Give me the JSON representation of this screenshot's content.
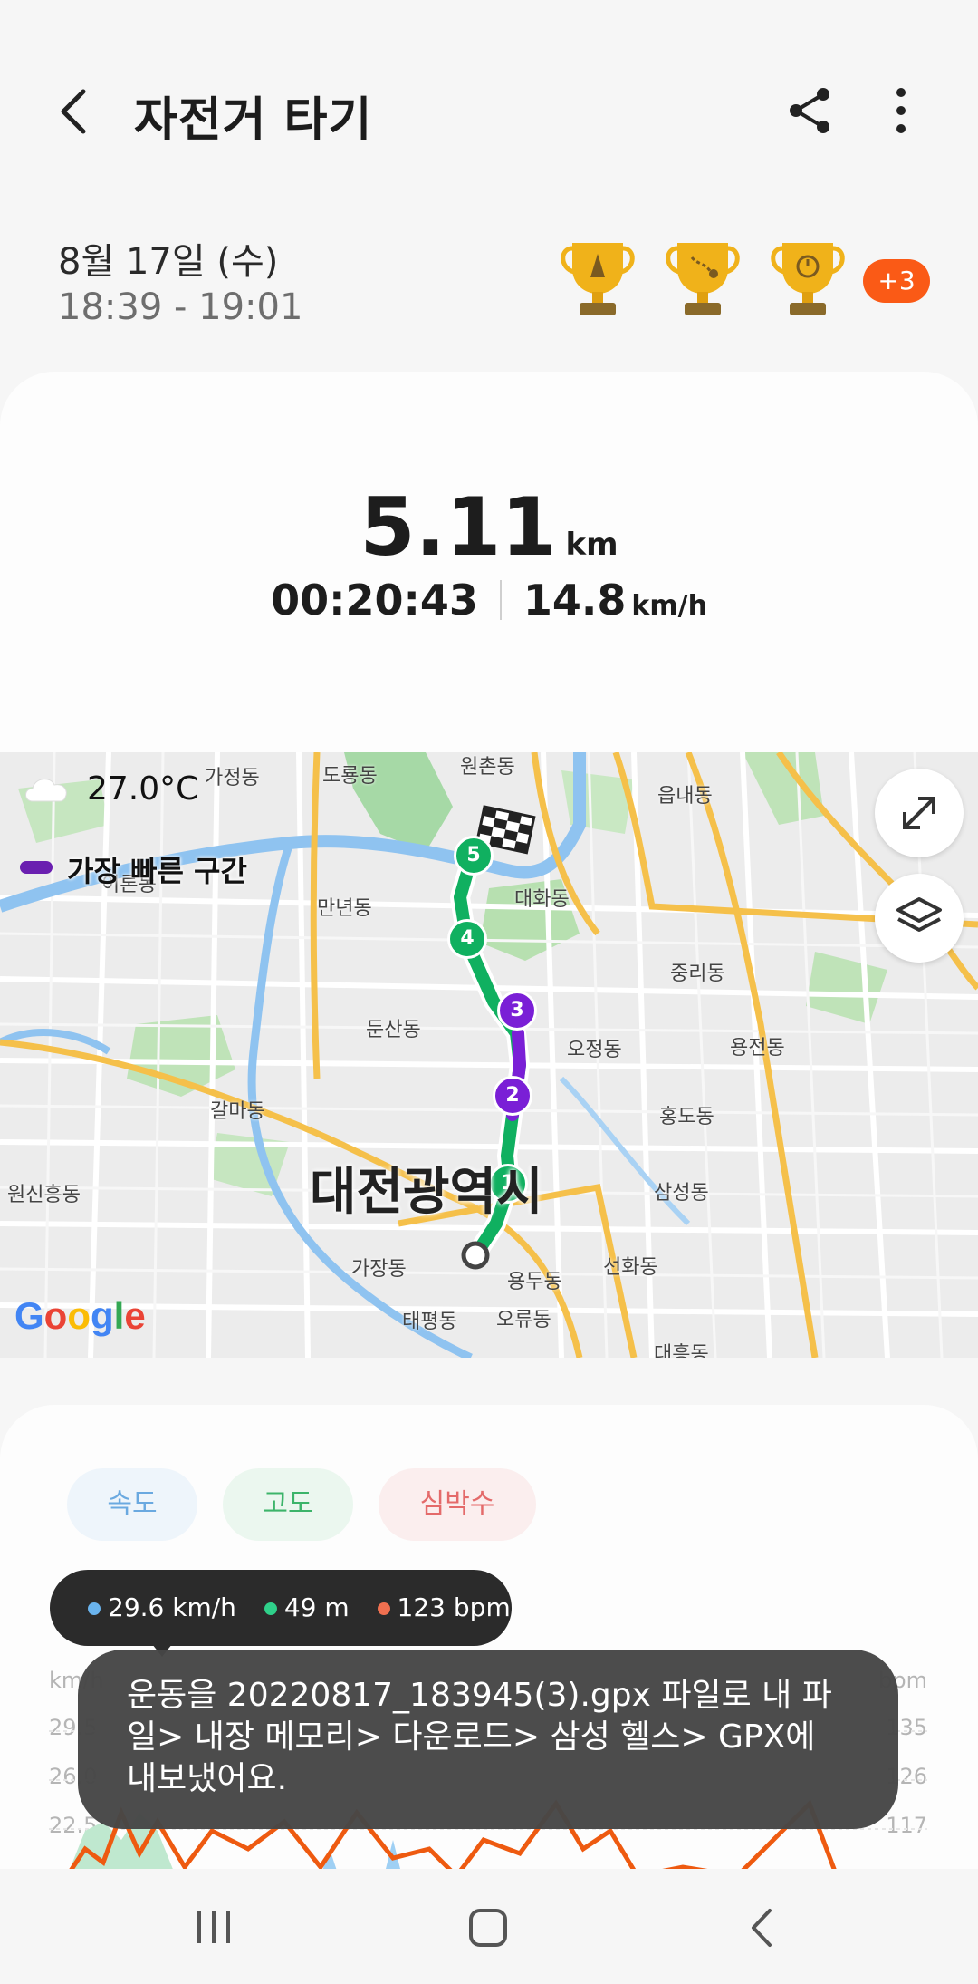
{
  "header": {
    "title": "자전거 타기"
  },
  "session": {
    "date": "8월 17일 (수)",
    "time_range": "18:39 - 19:01",
    "more_badges": "+3"
  },
  "summary": {
    "distance_value": "5.11",
    "distance_unit": "km",
    "duration": "00:20:43",
    "speed_value": "14.8",
    "speed_unit": "km/h"
  },
  "map": {
    "temperature": "27.0°C",
    "legend_fastest": "가장 빠른 구간",
    "city": "대전광역시",
    "google": "Google",
    "dongs": [
      "가정동",
      "도룡동",
      "원촌동",
      "읍내동",
      "대화동",
      "만년동",
      "중리동",
      "둔산동",
      "오정동",
      "용전동",
      "갈마동",
      "홍도동",
      "삼성동",
      "원신흥동",
      "가장동",
      "선화동",
      "용두동",
      "태평동",
      "오류동",
      "대흥동",
      "이론동"
    ],
    "markers": [
      "1",
      "2",
      "3",
      "4",
      "5"
    ]
  },
  "chart": {
    "tabs": {
      "speed": "속도",
      "altitude": "고도",
      "heart_rate": "심박수"
    },
    "left_unit": "km/h",
    "right_unit": "bpm",
    "left_ticks": [
      "29.5",
      "26.0",
      "22.5"
    ],
    "right_ticks": [
      "135",
      "126",
      "117"
    ]
  },
  "tooltip": {
    "speed": "29.6 km/h",
    "altitude": "49 m",
    "heart_rate": "123 bpm"
  },
  "toast": {
    "message": "운동을 20220817_183945(3).gpx 파일로 내 파일> 내장 메모리> 다운로드> 삼성 헬스> GPX에 내보냈어요."
  },
  "colors": {
    "route_green": "#10b060",
    "route_purple": "#7a1fd6",
    "badge_orange": "#fa5a16",
    "speed_blue": "#6ab4ee",
    "hr_orange": "#ee5a10"
  }
}
